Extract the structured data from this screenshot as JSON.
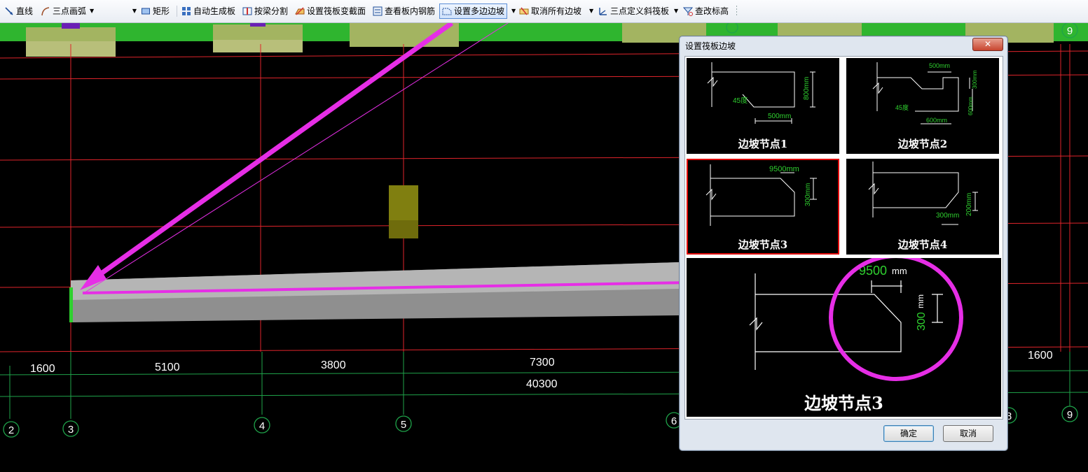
{
  "toolbar": {
    "line": "直线",
    "arc": "三点画弧",
    "rect": "矩形",
    "auto_slab": "自动生成板",
    "split_by_beam": "按梁分割",
    "raft_section": "设置筏板变截面",
    "view_rebar": "查看板内钢筋",
    "set_multi_slope": "设置多边边坡",
    "cancel_all_slopes": "取消所有边坡",
    "three_point_slope": "三点定义斜筏板",
    "check_elevation": "查改标高"
  },
  "drawing": {
    "dims_row1": [
      "1600",
      "5100",
      "3800",
      "7300",
      "1600"
    ],
    "dims_total": "40300",
    "axis_labels": [
      "2",
      "3",
      "4",
      "5",
      "6",
      "8",
      "9",
      "9"
    ]
  },
  "dialog": {
    "title": "设置筏板边坡",
    "close_symbol": "✕",
    "options": [
      {
        "label": "边坡节点1",
        "d1": "45度",
        "d2": "800mm",
        "d3": "500mm"
      },
      {
        "label": "边坡节点2",
        "d1": "500mm",
        "d2": "300mm",
        "d3": "600mm",
        "d4": "45度",
        "d5": "600mm"
      },
      {
        "label": "边坡节点3",
        "d1": "9500mm",
        "d2": "300mm"
      },
      {
        "label": "边坡节点4",
        "d1": "300mm",
        "d2": "200mm"
      }
    ],
    "preview": {
      "label": "边坡节点3",
      "dim_h": "9500",
      "dim_h_unit": "mm",
      "dim_v": "300",
      "dim_v_unit": "mm"
    },
    "ok": "确定",
    "cancel": "取消"
  },
  "colors": {
    "grid_red": "#e0242b",
    "grid_green": "#1fa34a",
    "annotation_magenta": "#e62ee6",
    "slab_gray": "#aaaaaa"
  }
}
